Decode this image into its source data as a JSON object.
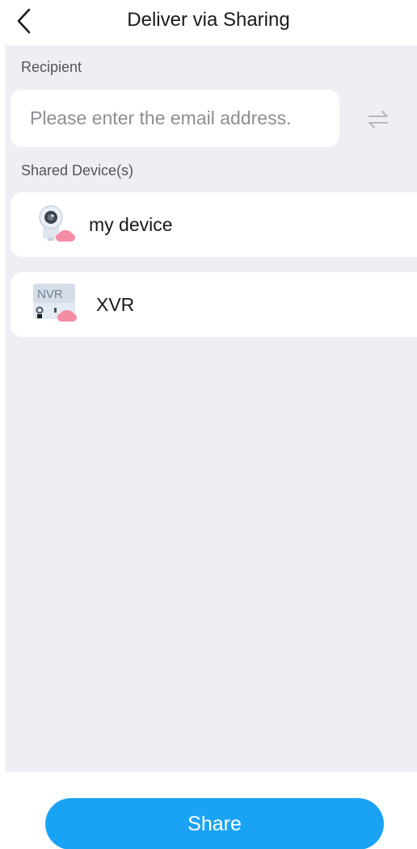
{
  "header": {
    "title": "Deliver via Sharing",
    "back_icon": "chevron-left-icon"
  },
  "recipient": {
    "label": "Recipient",
    "email_value": "",
    "email_placeholder": "Please enter the email address.",
    "swap_icon": "swap-arrows-icon"
  },
  "shared_devices": {
    "label": "Shared Device(s)",
    "items": [
      {
        "name": "my device",
        "icon": "camera-cloud-icon"
      },
      {
        "name": "XVR",
        "icon": "nvr-cloud-icon",
        "icon_text": "NVR"
      }
    ]
  },
  "actions": {
    "share_label": "Share"
  },
  "colors": {
    "accent": "#1aa3f5",
    "background": "#efeef5",
    "cloud_badge": "#f48ca3"
  }
}
